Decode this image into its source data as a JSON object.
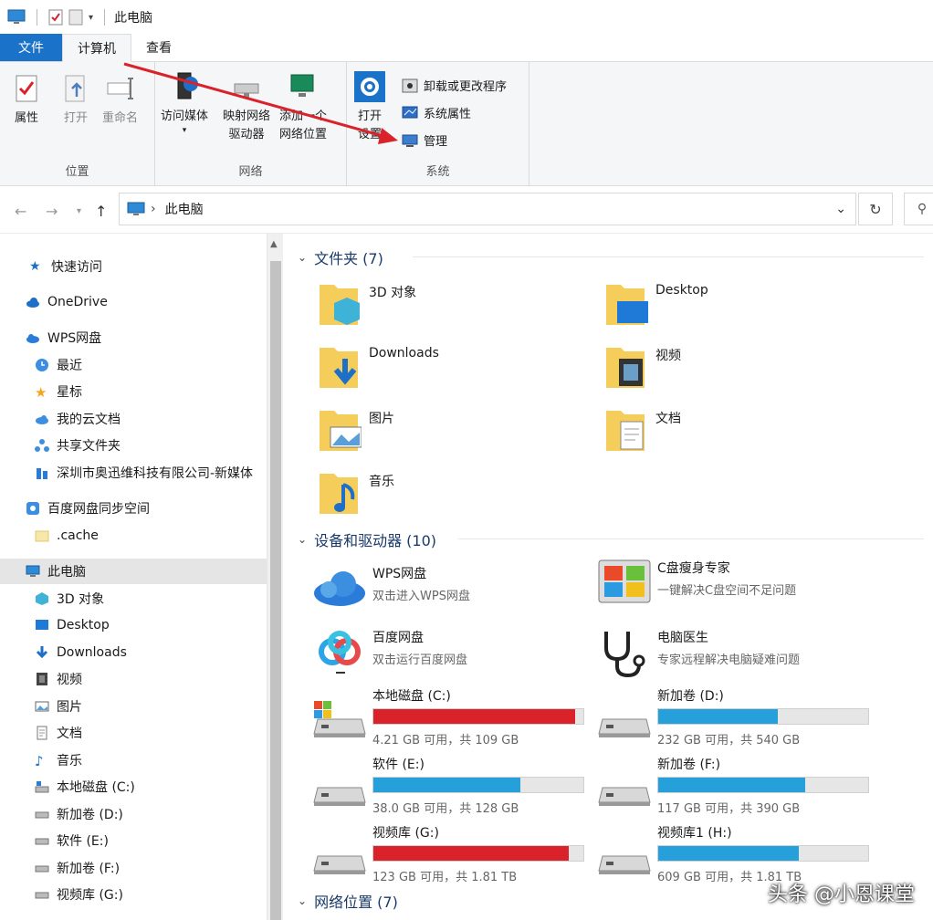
{
  "window": {
    "title": "此电脑"
  },
  "ribbon": {
    "tabs": [
      {
        "label": "文件"
      },
      {
        "label": "计算机"
      },
      {
        "label": "查看"
      }
    ],
    "location_group": {
      "label": "位置",
      "properties": "属性",
      "open": "打开",
      "rename": "重命名"
    },
    "network_group": {
      "label": "网络",
      "access_media": "访问媒体",
      "map_drive_line1": "映射网络",
      "map_drive_line2": "驱动器",
      "add_location_line1": "添加一个",
      "add_location_line2": "网络位置"
    },
    "system_group": {
      "label": "系统",
      "open_settings_line1": "打开",
      "open_settings_line2": "设置",
      "uninstall": "卸载或更改程序",
      "system_properties": "系统属性",
      "manage": "管理"
    }
  },
  "address": {
    "path": "此电脑"
  },
  "sidebar": {
    "items": [
      {
        "label": "快速访问"
      },
      {
        "label": "OneDrive"
      },
      {
        "label": "WPS网盘"
      },
      {
        "label": "最近"
      },
      {
        "label": "星标"
      },
      {
        "label": "我的云文档"
      },
      {
        "label": "共享文件夹"
      },
      {
        "label": "深圳市奥迅维科技有限公司-新媒体"
      },
      {
        "label": "百度网盘同步空间"
      },
      {
        "label": ".cache"
      },
      {
        "label": "此电脑"
      },
      {
        "label": "3D 对象"
      },
      {
        "label": "Desktop"
      },
      {
        "label": "Downloads"
      },
      {
        "label": "视频"
      },
      {
        "label": "图片"
      },
      {
        "label": "文档"
      },
      {
        "label": "音乐"
      },
      {
        "label": "本地磁盘 (C:)"
      },
      {
        "label": "新加卷 (D:)"
      },
      {
        "label": "软件 (E:)"
      },
      {
        "label": "新加卷 (F:)"
      },
      {
        "label": "视频库 (G:)"
      }
    ]
  },
  "sections": {
    "folders": {
      "title": "文件夹 (7)",
      "items": [
        {
          "name": "3D 对象"
        },
        {
          "name": "Desktop"
        },
        {
          "name": "Downloads"
        },
        {
          "name": "视频"
        },
        {
          "name": "图片"
        },
        {
          "name": "文档"
        },
        {
          "name": "音乐"
        }
      ]
    },
    "devices": {
      "title": "设备和驱动器 (10)",
      "apps": [
        {
          "name": "WPS网盘",
          "desc": "双击进入WPS网盘"
        },
        {
          "name": "C盘瘦身专家",
          "desc": "一键解决C盘空间不足问题"
        },
        {
          "name": "百度网盘",
          "desc": "双击运行百度网盘"
        },
        {
          "name": "电脑医生",
          "desc": "专家远程解决电脑疑难问题"
        }
      ],
      "drives": [
        {
          "name": "本地磁盘 (C:)",
          "free": "4.21 GB 可用，共 109 GB",
          "used_fraction": 0.96,
          "color": "#d9222a"
        },
        {
          "name": "新加卷 (D:)",
          "free": "232 GB 可用，共 540 GB",
          "used_fraction": 0.57,
          "color": "#26a0da"
        },
        {
          "name": "软件 (E:)",
          "free": "38.0 GB 可用，共 128 GB",
          "used_fraction": 0.7,
          "color": "#26a0da"
        },
        {
          "name": "新加卷 (F:)",
          "free": "117 GB 可用，共 390 GB",
          "used_fraction": 0.7,
          "color": "#26a0da"
        },
        {
          "name": "视频库 (G:)",
          "free": "123 GB 可用，共 1.81 TB",
          "used_fraction": 0.93,
          "color": "#d9222a"
        },
        {
          "name": "视频库1 (H:)",
          "free": "609 GB 可用，共 1.81 TB",
          "used_fraction": 0.67,
          "color": "#26a0da"
        }
      ]
    },
    "network": {
      "title": "网络位置 (7)"
    }
  },
  "watermark": {
    "text": "头条 @小恩课堂"
  },
  "colors": {
    "accent": "#1a73c8",
    "arrow": "#d9222a"
  }
}
